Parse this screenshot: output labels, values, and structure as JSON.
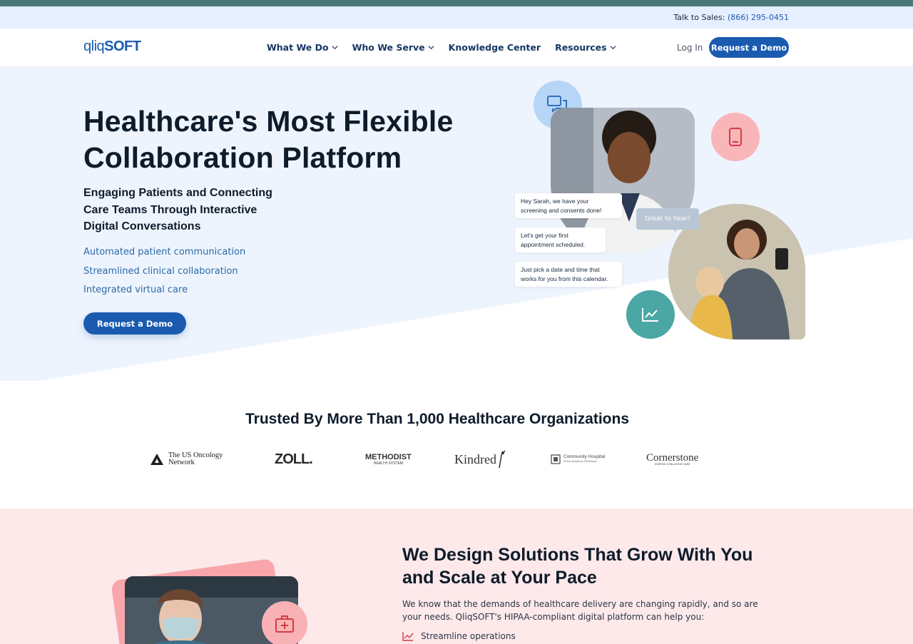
{
  "topbar": {
    "sales_label": "Talk to Sales:",
    "sales_phone": "(866) 295-0451"
  },
  "nav": {
    "logo_part1": "qliq",
    "logo_part2": "SOFT",
    "items": [
      {
        "label": "What We Do",
        "dropdown": true
      },
      {
        "label": "Who We Serve",
        "dropdown": true
      },
      {
        "label": "Knowledge Center",
        "dropdown": false
      },
      {
        "label": "Resources",
        "dropdown": true
      }
    ],
    "login": "Log In",
    "cta": "Request a Demo"
  },
  "hero": {
    "title": "Healthcare's Most Flexible Collaboration Platform",
    "subtitle": "Engaging Patients and Connecting Care Teams Through Interactive Digital Conversations",
    "bullets": [
      "Automated patient communication",
      "Streamlined clinical collaboration",
      "Integrated virtual care"
    ],
    "cta": "Request a Demo",
    "chat": {
      "msg1": "Hey Sarah, we have your screening and consents done!",
      "msg2": "Let's get your first appointment scheduled.",
      "msg3": "Just pick a date and time that works for you from this calendar.",
      "reply": "Great to hear!"
    },
    "icons": [
      "chat-icon",
      "phone-icon",
      "chart-icon"
    ]
  },
  "trusted": {
    "title": "Trusted By More Than 1,000 Healthcare Organizations",
    "logos": [
      {
        "name": "The US Oncology Network",
        "line1": "The US Oncology",
        "line2": "Network"
      },
      {
        "name": "ZOLL",
        "text": "ZOLL."
      },
      {
        "name": "Methodist Health System",
        "text": "METHODIST",
        "sub": "HEALTH SYSTEM"
      },
      {
        "name": "Kindred",
        "text": "Kindred"
      },
      {
        "name": "Community Hospital of the Monterey Peninsula",
        "text": "Community Hospital",
        "sub": "of the Monterey Peninsula"
      },
      {
        "name": "Cornerstone",
        "text": "Cornerstone",
        "sub": "HOSPICE & PALLIATIVE CARE"
      }
    ]
  },
  "section2": {
    "title": "We Design Solutions That Grow With You and Scale at Your Pace",
    "body": "We know that the demands of healthcare delivery are changing rapidly, and so are your needs. QliqSOFT's HIPAA-compliant digital platform can help you:",
    "items": [
      "Streamline operations"
    ]
  },
  "colors": {
    "brand_blue": "#1a5bb0",
    "teal": "#4a7878",
    "hero_bg": "#eef4fd",
    "pink_bg": "#fde9ea"
  }
}
